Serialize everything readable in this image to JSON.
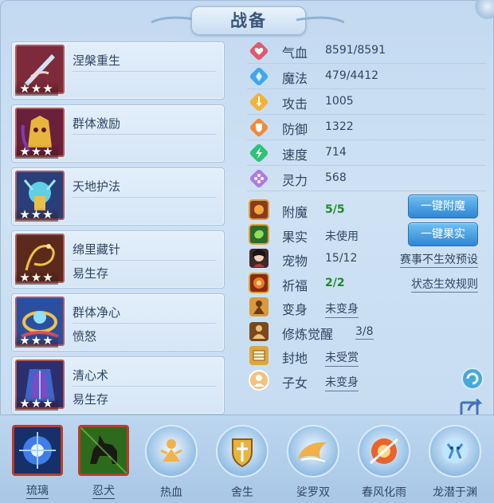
{
  "window": {
    "title": "战备"
  },
  "skills": [
    {
      "name": "涅槃重生",
      "stars": "★★★",
      "effect": "",
      "icon": "phoenix-blade-icon",
      "bg": "#7d2a3a"
    },
    {
      "name": "群体激励",
      "stars": "★★★",
      "effect": "",
      "icon": "golden-mask-icon",
      "bg": "#6a1f3a"
    },
    {
      "name": "天地护法",
      "stars": "★★★",
      "effect": "",
      "icon": "guardian-icon",
      "bg": "#2a3f7a"
    },
    {
      "name": "绵里藏针",
      "stars": "★★★",
      "effect": "易生存",
      "icon": "needle-thread-icon",
      "bg": "#5b2a1c"
    },
    {
      "name": "群体净心",
      "stars": "★★★",
      "effect": "愤怒",
      "icon": "purify-ring-icon",
      "bg": "#2b4fa0"
    },
    {
      "name": "清心术",
      "stars": "★★★",
      "effect": "易生存",
      "icon": "cloak-icon",
      "bg": "#2c2f6d"
    }
  ],
  "attributes": [
    {
      "label": "气血",
      "value": "8591/8591",
      "icon": "heart-icon",
      "color": "#e15a6b"
    },
    {
      "label": "魔法",
      "value": "479/4412",
      "icon": "mana-icon",
      "color": "#43a6ea"
    },
    {
      "label": "攻击",
      "value": "1005",
      "icon": "sword-icon",
      "color": "#f2b33a"
    },
    {
      "label": "防御",
      "value": "1322",
      "icon": "shield-icon",
      "color": "#f08a3a"
    },
    {
      "label": "速度",
      "value": "714",
      "icon": "lightning-icon",
      "color": "#2ec27a"
    },
    {
      "label": "灵力",
      "value": "568",
      "icon": "spirit-icon",
      "color": "#b07ae0"
    }
  ],
  "status": {
    "enchant": {
      "label": "附魔",
      "value": "5/5",
      "button": "一键附魔"
    },
    "fruit": {
      "label": "果实",
      "value": "未使用",
      "button": "一键果实"
    },
    "pet": {
      "label": "宠物",
      "value": "15/12",
      "link": "赛事不生效预设"
    },
    "blessing": {
      "label": "祈福",
      "value": "2/2",
      "link": "状态生效规则"
    },
    "transform": {
      "label": "变身",
      "value": "未变身"
    },
    "cultivation": {
      "label": "修炼觉醒",
      "value": "3/8"
    },
    "seal": {
      "label": "封地",
      "value": "未受赏"
    },
    "child": {
      "label": "子女",
      "value": "未变身"
    }
  },
  "bottom_bar": [
    {
      "label": "琉璃",
      "style": "square",
      "icon": "glass-orb-icon",
      "underlined": true
    },
    {
      "label": "忍犬",
      "style": "square",
      "icon": "ninja-dog-icon",
      "underlined": true
    },
    {
      "label": "热血",
      "style": "round",
      "icon": "hot-blood-icon",
      "underlined": false
    },
    {
      "label": "舍生",
      "style": "round",
      "icon": "sacrifice-shield-icon",
      "underlined": false
    },
    {
      "label": "娑罗双",
      "style": "round",
      "icon": "twin-wing-icon",
      "underlined": false
    },
    {
      "label": "春风化雨",
      "style": "round",
      "icon": "spring-breeze-icon",
      "underlined": false
    },
    {
      "label": "龙潜于渊",
      "style": "round",
      "icon": "dragon-icon",
      "underlined": false
    }
  ]
}
